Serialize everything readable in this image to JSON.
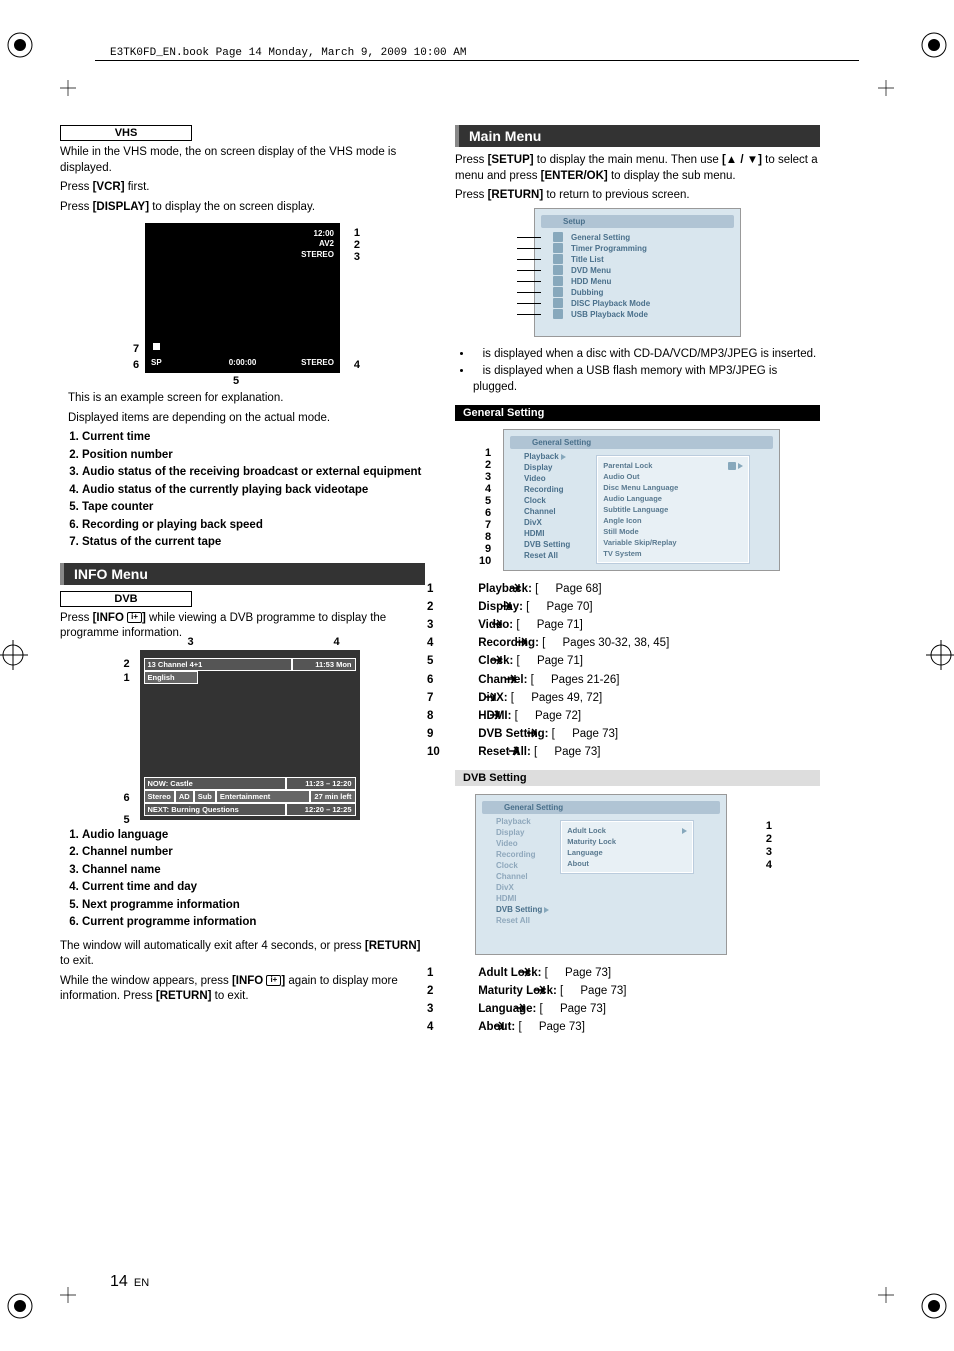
{
  "header": {
    "runhead": "E3TK0FD_EN.book  Page 14  Monday, March 9, 2009  10:00 AM"
  },
  "vhs": {
    "tag": "VHS",
    "p1": "While in the VHS mode, the on screen display of the VHS mode is displayed.",
    "p2a": "Press ",
    "p2b": "[VCR]",
    "p2c": " first.",
    "p3a": "Press ",
    "p3b": "[DISPLAY]",
    "p3c": " to display the on screen display.",
    "screen": {
      "time": "12:00",
      "pos": "AV2",
      "audio": "STEREO",
      "speed": "SP",
      "counter": "0:00:00",
      "audio2": "STEREO"
    },
    "caption1": "This is an example screen for explanation.",
    "caption2": "Displayed items are depending on the actual mode.",
    "items": [
      "Current time",
      "Position number",
      "Audio status of the receiving broadcast or external equipment",
      "Audio status of the currently playing back videotape",
      "Tape counter",
      "Recording or playing back speed",
      "Status of the current tape"
    ]
  },
  "info": {
    "title": "INFO Menu",
    "tag": "DVB",
    "p1a": "Press ",
    "p1b": "[INFO ",
    "p1c": "]",
    "p1d": " while viewing a DVB programme to display the programme information.",
    "screen": {
      "ch_desc": "13 Channel 4+1",
      "clock": "11:53 Mon",
      "lang": "English",
      "now_label": "NOW: Castle",
      "now_time": "11:23 – 12:20",
      "row_a": "Stereo",
      "row_b": "AD",
      "row_c": "Sub",
      "row_d": "Entertainment",
      "row_e": "27 min left",
      "next_label": "NEXT: Burning Questions",
      "next_time": "12:20 – 12:25"
    },
    "items": [
      "Audio language",
      "Channel number",
      "Channel name",
      "Current time and day",
      "Next programme information",
      "Current programme information"
    ],
    "p2a": "The window will automatically exit after 4 seconds, or press ",
    "p2b": "[RETURN]",
    "p2c": " to exit.",
    "p3a": "While the window appears, press ",
    "p3b": "[INFO ",
    "p3c": "]",
    "p3d": " again to display more information. Press ",
    "p3e": "[RETURN]",
    "p3f": " to exit."
  },
  "main": {
    "title": "Main Menu",
    "p1a": "Press ",
    "p1b": "[SETUP]",
    "p1c": " to display the main menu. Then use ",
    "p1d": "[▲ / ▼]",
    "p1e": " to select a menu and press ",
    "p1f": "[ENTER/OK]",
    "p1g": " to display the sub menu.",
    "p2a": "Press ",
    "p2b": "[RETURN]",
    "p2c": " to return to previous screen.",
    "menu": {
      "header": "Setup",
      "items": [
        "General Setting",
        "Timer Programming",
        "Title List",
        "DVD Menu",
        "HDD Menu",
        "Dubbing",
        "DISC Playback Mode",
        "USB Playback Mode"
      ]
    },
    "b1": "is displayed when a disc with CD-DA/VCD/MP3/JPEG is inserted.",
    "b2": "is displayed when a USB flash memory with MP3/JPEG is plugged."
  },
  "gs": {
    "bar": "General Setting",
    "header": "General Setting",
    "left": [
      "Playback",
      "Display",
      "Video",
      "Recording",
      "Clock",
      "Channel",
      "DivX",
      "HDMI",
      "DVB Setting",
      "Reset All"
    ],
    "right": [
      "Parental Lock",
      "Audio Out",
      "Disc Menu Language",
      "Audio Language",
      "Subtitle Language",
      "Angle Icon",
      "Still Mode",
      "Variable Skip/Replay",
      "TV System"
    ],
    "refs": [
      {
        "n": "1",
        "lbl": "Playback:",
        "pg": "Page 68]"
      },
      {
        "n": "2",
        "lbl": "Display:",
        "pg": "Page 70]"
      },
      {
        "n": "3",
        "lbl": "Video:",
        "pg": "Page 71]"
      },
      {
        "n": "4",
        "lbl": "Recording:",
        "pg": "Pages 30-32, 38, 45]"
      },
      {
        "n": "5",
        "lbl": "Clock:",
        "pg": "Page 71]"
      },
      {
        "n": "6",
        "lbl": "Channel:",
        "pg": "Pages 21-26]"
      },
      {
        "n": "7",
        "lbl": "DivX:",
        "pg": "Pages 49, 72]"
      },
      {
        "n": "8",
        "lbl": "HDMI:",
        "pg": "Page 72]"
      },
      {
        "n": "9",
        "lbl": "DVB Setting:",
        "pg": "Page 73]"
      },
      {
        "n": "10",
        "lbl": "Reset All:",
        "pg": "Page 73]"
      }
    ]
  },
  "dvb": {
    "bar": "DVB Setting",
    "header": "General Setting",
    "left": [
      "Playback",
      "Display",
      "Video",
      "Recording",
      "Clock",
      "Channel",
      "DivX",
      "HDMI",
      "DVB Setting",
      "Reset All"
    ],
    "right": [
      "Adult Lock",
      "Maturity Lock",
      "Language",
      "About"
    ],
    "refs": [
      {
        "n": "1",
        "lbl": "Adult Lock:",
        "pg": "Page 73]"
      },
      {
        "n": "2",
        "lbl": "Maturity Lock:",
        "pg": "Page 73]"
      },
      {
        "n": "3",
        "lbl": "Language:",
        "pg": "Page 73]"
      },
      {
        "n": "4",
        "lbl": "About:",
        "pg": "Page 73]"
      }
    ]
  },
  "footer": {
    "page": "14",
    "lang": "EN"
  }
}
